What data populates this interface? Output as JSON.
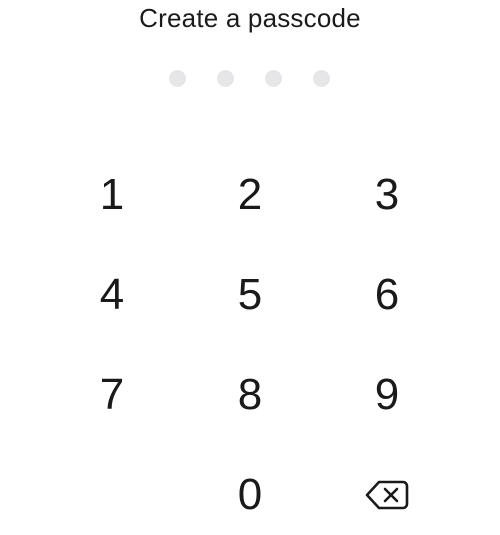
{
  "screen": {
    "title": "Create a passcode"
  },
  "passcode": {
    "length": 4,
    "entered": 0,
    "dot_color": "#e6e6e8"
  },
  "keypad": {
    "keys": [
      "1",
      "2",
      "3",
      "4",
      "5",
      "6",
      "7",
      "8",
      "9",
      "0"
    ],
    "delete_icon": "backspace-icon"
  },
  "colors": {
    "text": "#1a1a1a",
    "background": "#ffffff"
  }
}
